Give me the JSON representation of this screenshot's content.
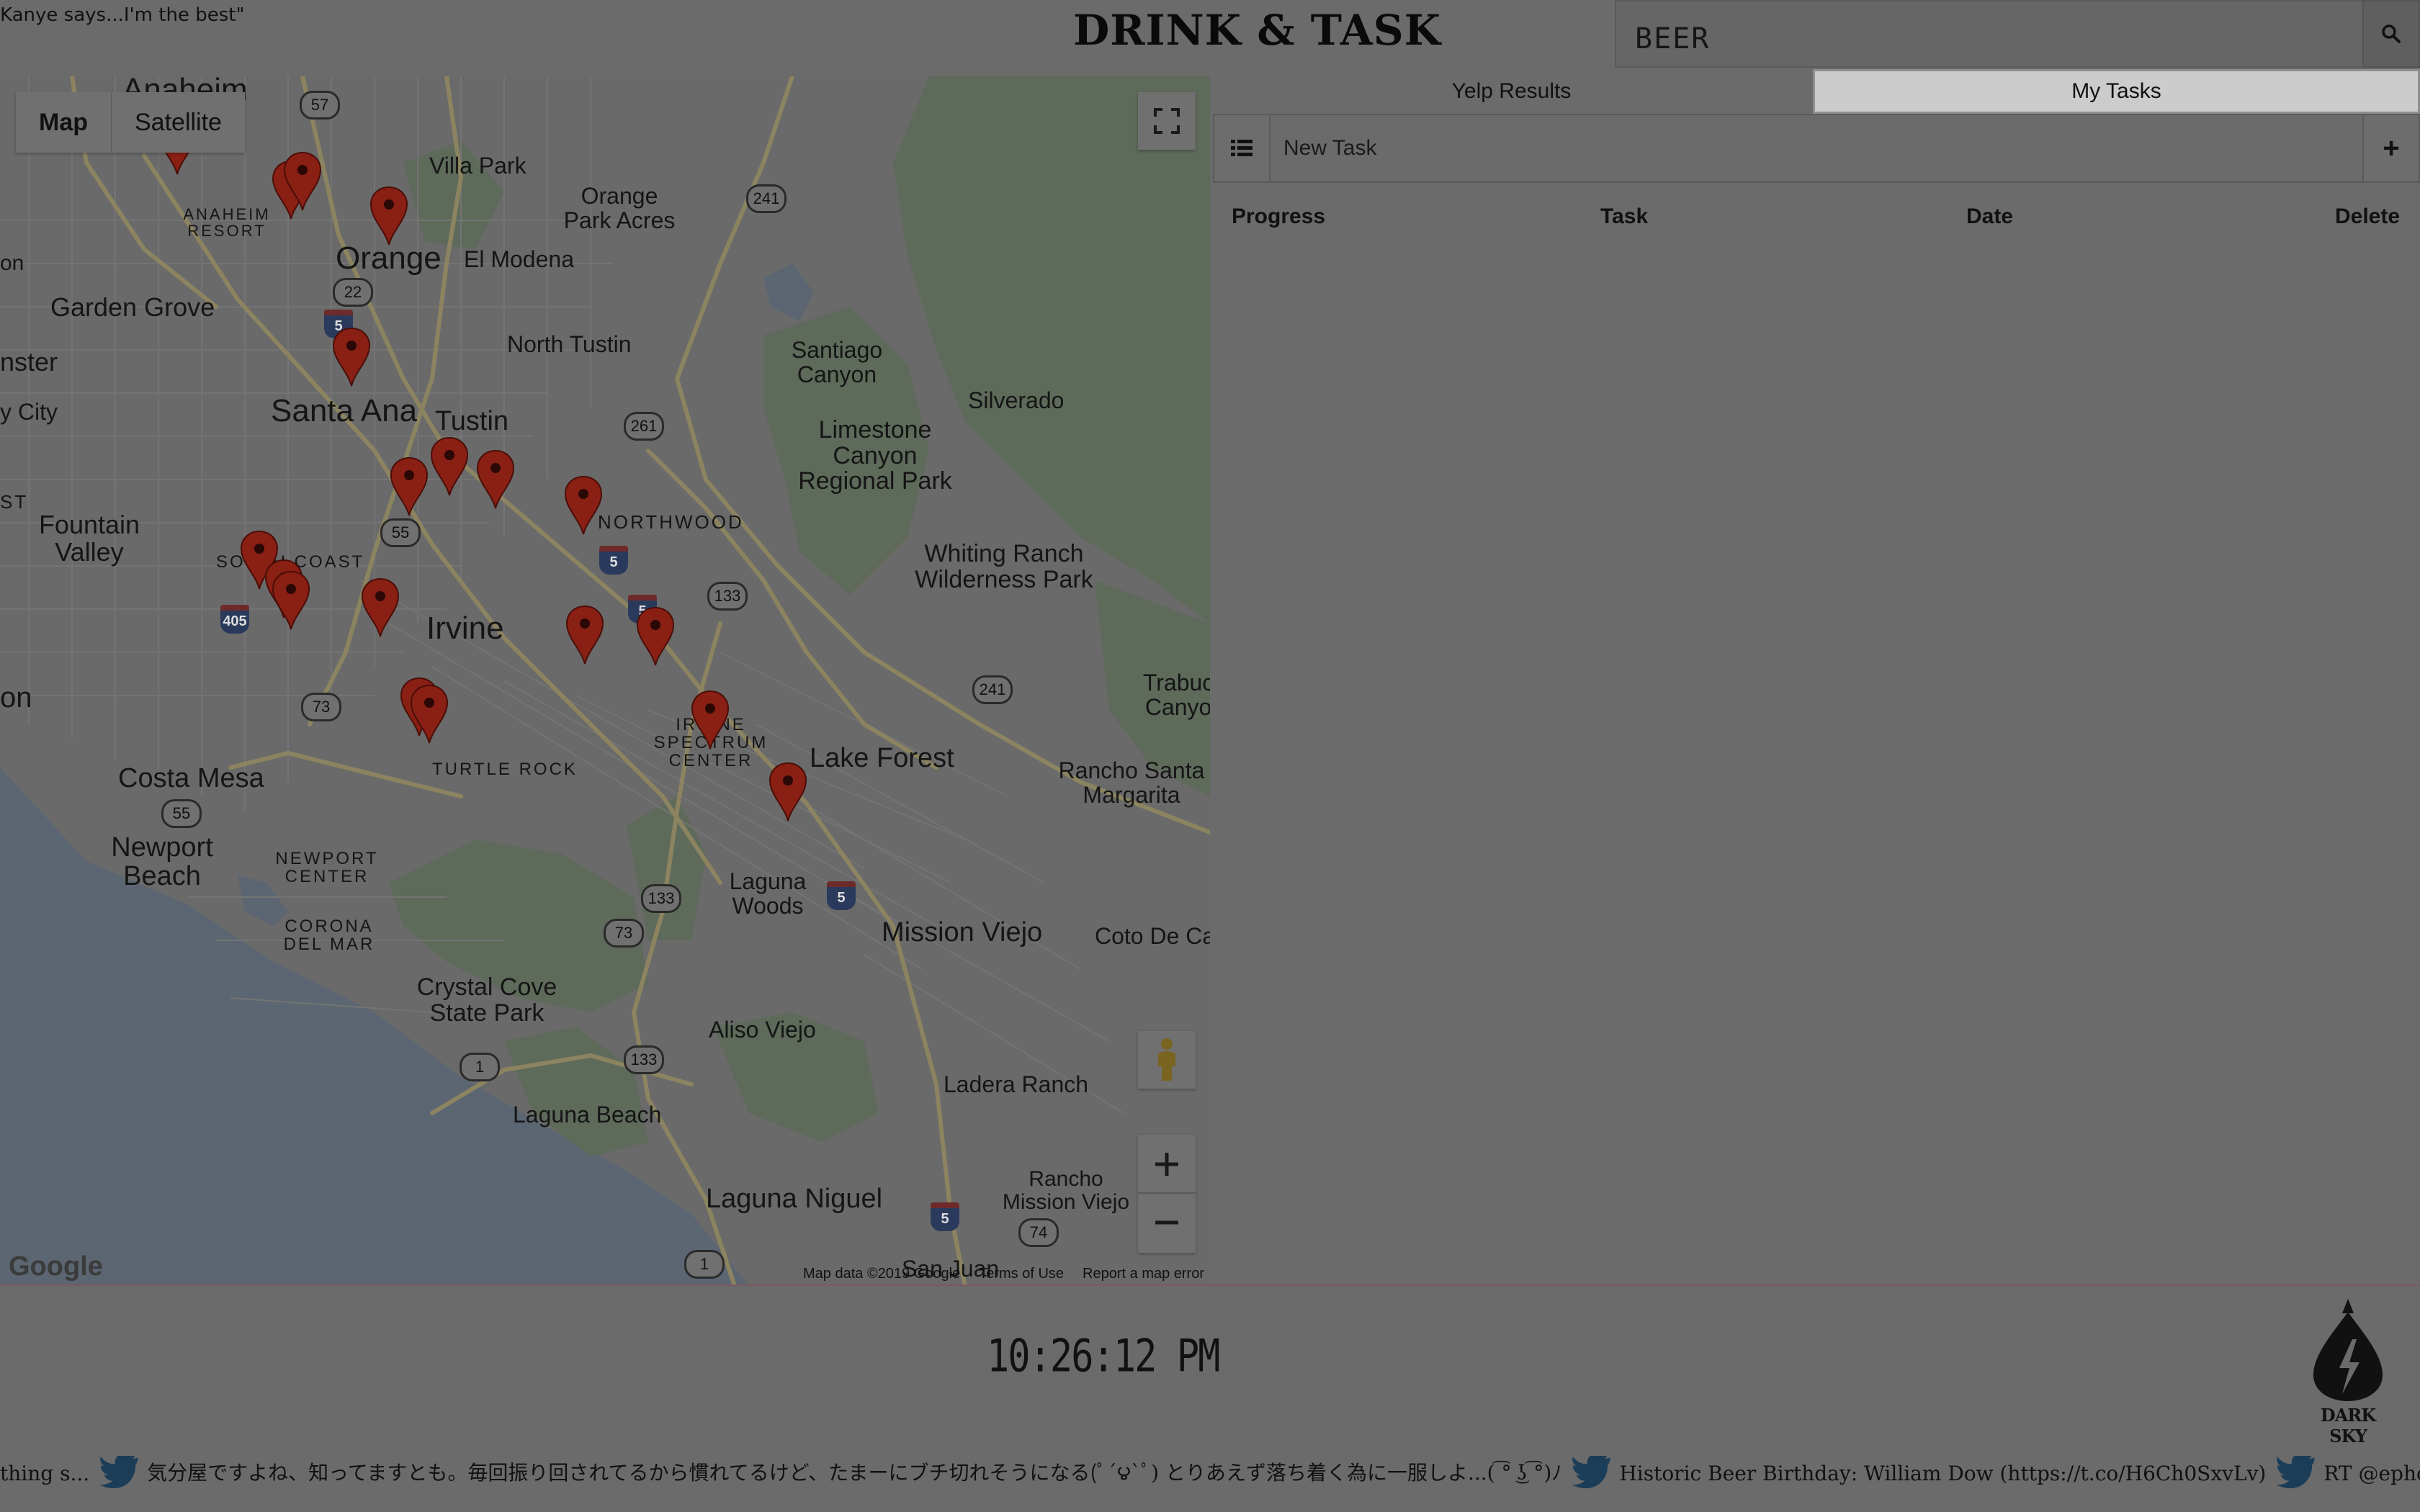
{
  "header": {
    "quote": "Kanye says...I'm the best\"",
    "title": "DRINK & TASK",
    "search": {
      "value": "BEER",
      "placeholder": ""
    }
  },
  "map": {
    "type_buttons": [
      "Map",
      "Satellite"
    ],
    "labels": {
      "anaheim": "Anaheim",
      "anaheim_resort": "ANAHEIM RESORT",
      "villa_park": "Villa Park",
      "orange": "Orange",
      "orange_park_acres": "Orange Park Acres",
      "el_modena": "El Modena",
      "garden_grove": "Garden Grove",
      "north_tustin": "North Tustin",
      "santiago_canyon": "Santiago Canyon",
      "silverado": "Silverado",
      "nster": "nster",
      "y_city": "y City",
      "santa_ana": "Santa Ana",
      "tustin": "Tustin",
      "limestone": "Limestone Canyon Regional Park",
      "fountain_valley": "Fountain Valley",
      "south_coast": "SOUTH COAST",
      "northwood": "NORTHWOOD",
      "whiting_ranch": "Whiting Ranch Wilderness Park",
      "irvine": "Irvine",
      "trabuco": "Trabuco Canyon",
      "on": "on",
      "on2": "on",
      "st": "ST",
      "irvine_spectrum": "IRVINE SPECTRUM CENTER",
      "turtle_rock": "TURTLE ROCK",
      "lake_forest": "Lake Forest",
      "rancho_santa_margarita": "Rancho Santa Margarita",
      "costa_mesa": "Costa Mesa",
      "newport_beach": "Newport Beach",
      "newport_center": "NEWPORT CENTER",
      "laguna_woods": "Laguna Woods",
      "mission_viejo": "Mission Viejo",
      "coto_de_caza": "Coto De Ca",
      "corona_del_mar": "CORONA DEL MAR",
      "crystal_cove": "Crystal Cove State Park",
      "aliso_viejo": "Aliso Viejo",
      "ladera_ranch": "Ladera Ranch",
      "laguna_beach": "Laguna Beach",
      "rancho_mission_viejo": "Rancho Mission Viejo",
      "laguna_niguel": "Laguna Niguel",
      "san_juan": "San Juan"
    },
    "shields": {
      "s57": "57",
      "s241a": "241",
      "s22": "22",
      "s5a": "5",
      "s261": "261",
      "s55a": "55",
      "s5b": "5",
      "s5c": "5",
      "s133a": "133",
      "s405": "405",
      "s241b": "241",
      "s73a": "73",
      "s55b": "55",
      "s133b": "133",
      "s5d": "5",
      "s73b": "73",
      "s1a": "1",
      "s133c": "133",
      "s5e": "5",
      "s74": "74",
      "s1b": "1"
    },
    "logo": "Google",
    "footer": [
      "Map data ©2019 Google",
      "Terms of Use",
      "Report a map error"
    ]
  },
  "tabs": [
    "Yelp Results",
    "My Tasks"
  ],
  "active_tab": "My Tasks",
  "task_form": {
    "placeholder": "New Task",
    "add_label": "+"
  },
  "task_table": {
    "columns": [
      "Progress",
      "Task",
      "Date",
      "Delete"
    ]
  },
  "footer": {
    "clock": "10:26:12 PM",
    "darksky_label": "DARK SKY",
    "tweets": [
      "thing s...",
      "気分屋ですよね、知ってますとも。毎回振り回されてるから慣れてるけど、たまーにブチ切れそうになる(ﾟ´౪`ﾟ) とりあえず落ち着く為に一服しよ...( ͡° ͜ʖ ͡°)ﾉ",
      "Historic Beer Birthday: William Dow (https://t.co/H6Ch0SxvLv)",
      "RT @ephoustonbill: Thes"
    ]
  },
  "colors": {
    "overlay": "#6b6b6b",
    "pin": "#8a1f14",
    "tab_active": "#cccccc"
  },
  "icons": [
    "search-icon",
    "fullscreen-icon",
    "pegman-icon",
    "zoom-in-icon",
    "zoom-out-icon",
    "list-icon",
    "twitter-bird-icon",
    "darksky-logo-icon"
  ]
}
